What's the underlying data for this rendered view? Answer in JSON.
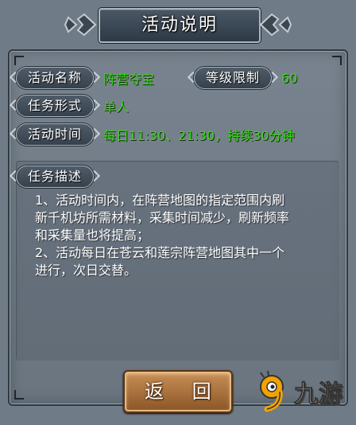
{
  "dialog": {
    "title": "活动说明",
    "fields": [
      {
        "label": "活动名称",
        "value": "阵营夺宝"
      },
      {
        "label": "等级限制",
        "value": "60"
      },
      {
        "label": "任务形式",
        "value": "单人"
      },
      {
        "label": "活动时间",
        "value": "每日11:30、21:30，持续30分钟"
      }
    ],
    "description": {
      "label": "任务描述",
      "lines": [
        "1、活动时间内，在阵营地图的指定范围内刷",
        "新千机坊所需材料，采集时间减少，刷新频率",
        "和采集量也将提高；",
        "2、活动每日在苍云和莲宗阵营地图其中一个",
        "进行，次日交替。"
      ]
    },
    "back_button": "返 回"
  },
  "watermark": {
    "text": "九游"
  },
  "colors": {
    "value_green": "#3bd61e",
    "button_brown": "#a96b35"
  }
}
